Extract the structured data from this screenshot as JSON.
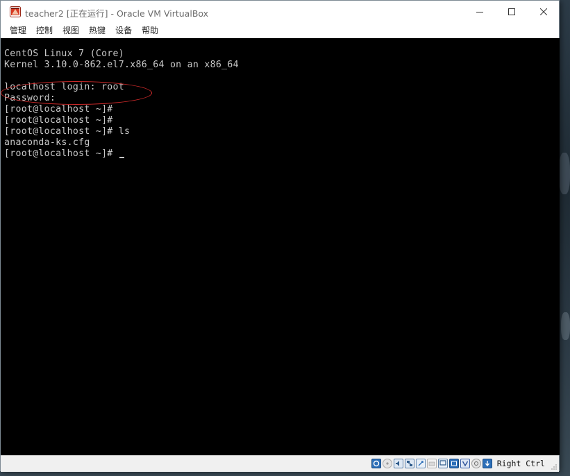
{
  "window": {
    "title": "teacher2 [正在运行] - Oracle VM VirtualBox"
  },
  "menu": {
    "items": [
      "管理",
      "控制",
      "视图",
      "热键",
      "设备",
      "帮助"
    ]
  },
  "console": {
    "lines": [
      "CentOS Linux 7 (Core)",
      "Kernel 3.10.0-862.el7.x86_64 on an x86_64",
      "",
      "localhost login: root",
      "Password:",
      "[root@localhost ~]#",
      "[root@localhost ~]#",
      "[root@localhost ~]# ls",
      "anaconda-ks.cfg",
      "[root@localhost ~]# "
    ]
  },
  "statusbar": {
    "host_key_label": "Right Ctrl",
    "icons": [
      "harddisk-icon",
      "optical-disk-icon",
      "audio-icon",
      "network-icon",
      "usb-icon",
      "shared-folder-icon",
      "display-icon",
      "video-capture-icon",
      "virtualization-icon",
      "cpu-icon",
      "mouse-integration-icon"
    ]
  },
  "colors": {
    "console_bg": "#000000",
    "console_text": "#c8c8c8",
    "annotation": "#d02a2a"
  }
}
